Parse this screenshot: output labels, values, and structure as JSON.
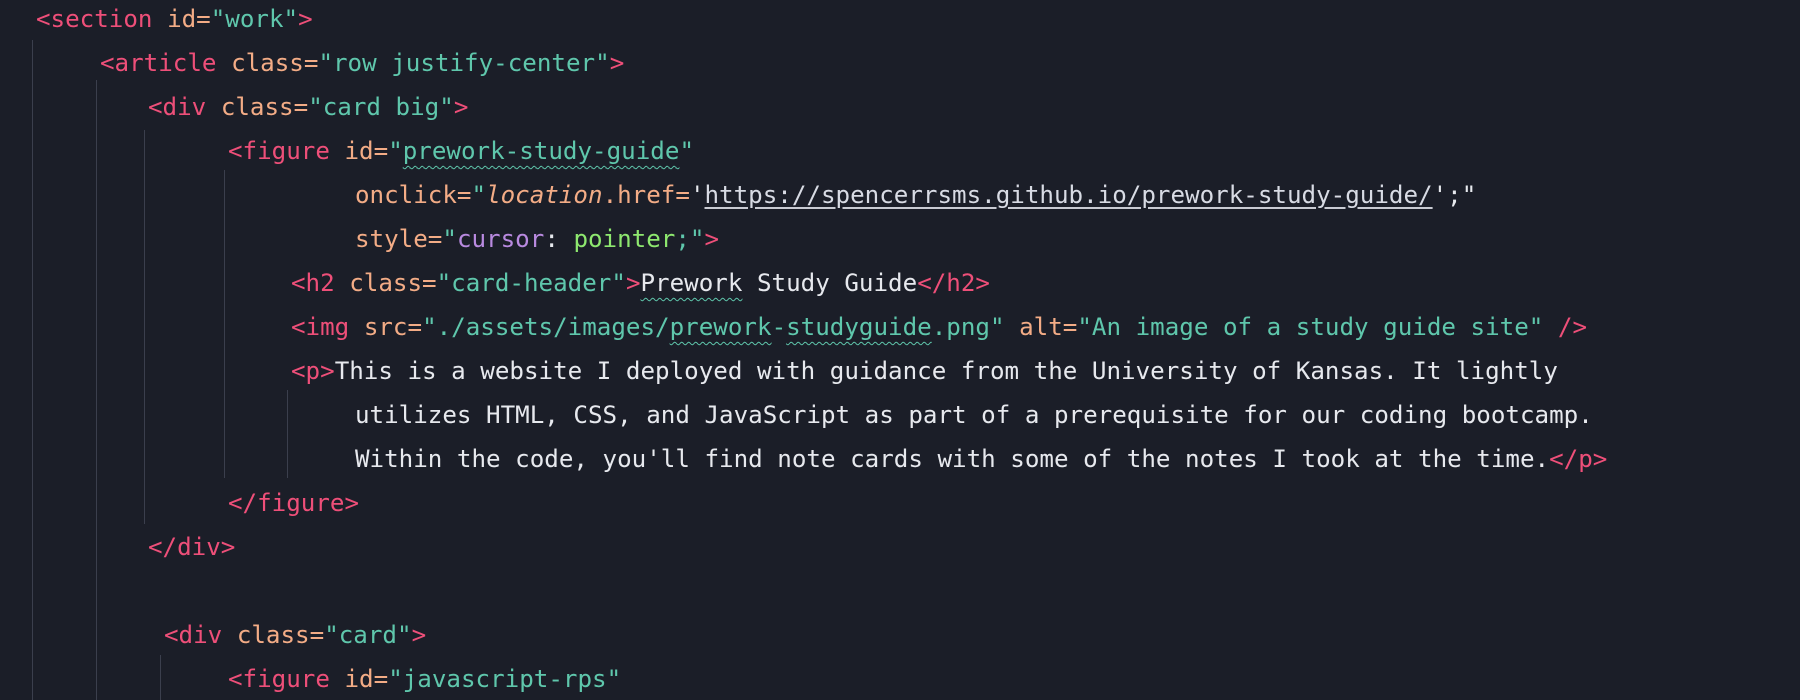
{
  "editor": {
    "lines": [
      {
        "tag_open": "<section",
        "attr1": "id=",
        "val1": "\"work\"",
        "tag_close": ">"
      },
      {
        "tag_open": "<article",
        "attr1": "class=",
        "val1": "\"row justify-center\"",
        "tag_close": ">"
      },
      {
        "tag_open": "<div",
        "attr1": "class=",
        "val1": "\"card big\"",
        "tag_close": ">"
      },
      {
        "tag_open": "<figure",
        "attr1": "id=",
        "val1_a": "\"",
        "val1_b": "prework-study-guide",
        "val1_c": "\""
      },
      {
        "attr1": "onclick=",
        "val1_a": "\"",
        "val1_loc": "location",
        "val1_href": ".href=",
        "val1_q1": "'",
        "val1_url": "https://spencerrsms.github.io/prework-study-guide/",
        "val1_q2": "';\""
      },
      {
        "attr1": "style=",
        "val1_a": "\"",
        "val1_prop": "cursor",
        "val1_colon": ": ",
        "val1_kw": "pointer",
        "val1_end": ";\"",
        "tag_close": ">"
      },
      {
        "tag_open": "<h2",
        "attr1": "class=",
        "val1": "\"card-header\"",
        "tag_gt": ">",
        "text_a": "Prework",
        "text_b": " Study Guide",
        "tag_end": "</h2>"
      },
      {
        "tag_open": "<img",
        "attr1": "src=",
        "val1_a": "\"./assets/images/",
        "val1_b": "prework",
        "val1_c": "-",
        "val1_d": "studyguide",
        "val1_e": ".png\"",
        "attr2": " alt=",
        "val2": "\"An image of a study guide site\"",
        "tag_end": " />"
      },
      {
        "tag_open": "<p>",
        "text": "This is a website I deployed with guidance from the University of Kansas. It lightly"
      },
      {
        "text": "utilizes HTML, CSS, and JavaScript as part of a prerequisite for our coding bootcamp."
      },
      {
        "text": "Within the code, you'll find note cards with some of the notes I took at the time.",
        "tag_end": "</p>"
      },
      {
        "tag_end": "</figure>"
      },
      {
        "tag_end": "</div>"
      },
      {
        "text": ""
      },
      {
        "tag_open": "<div",
        "attr1": "class=",
        "val1": "\"card\"",
        "tag_close": ">"
      },
      {
        "tag_open": "<figure",
        "attr1": "id=",
        "val1": "\"javascript-rps\""
      }
    ]
  }
}
